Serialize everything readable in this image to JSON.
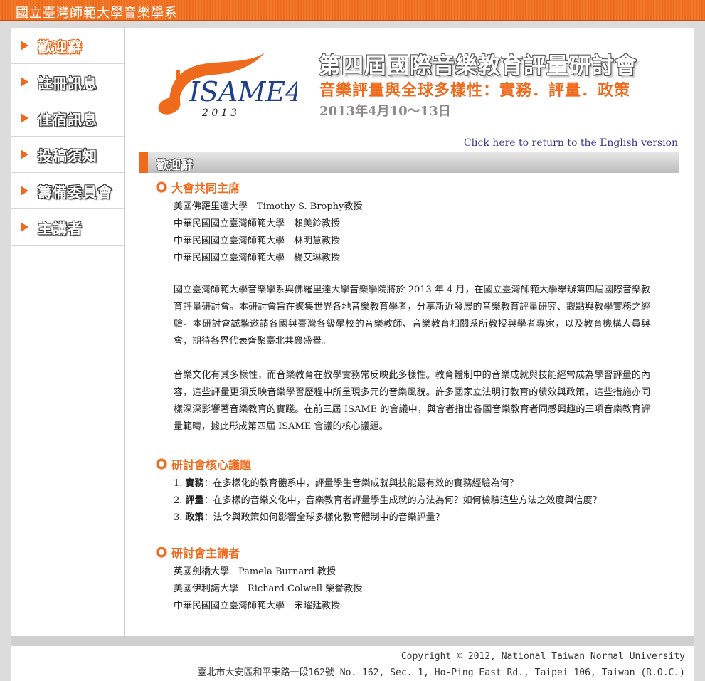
{
  "site": {
    "title": "國立臺灣師範大學音樂學系"
  },
  "sidebar": {
    "items": [
      {
        "label": "歡迎辭",
        "active": true
      },
      {
        "label": "註冊訊息",
        "active": false
      },
      {
        "label": "住宿訊息",
        "active": false
      },
      {
        "label": "投稿須知",
        "active": false
      },
      {
        "label": "籌備委員會",
        "active": false
      },
      {
        "label": "主講者",
        "active": false
      }
    ]
  },
  "header": {
    "logo_text": "ISAME4",
    "logo_year": "2 0 1 3",
    "title": "第四屆國際音樂教育評量研討會",
    "subtitle": "音樂評量與全球多樣性：實務．評量．政策",
    "date": "2013年4月10～13日",
    "english_link": "Click here to return to the English version"
  },
  "section": {
    "title": "歡迎辭"
  },
  "cochairs": {
    "heading": "大會共同主席",
    "lines": [
      "美國佛羅里達大學　Timothy S. Brophy教授",
      "中華民國國立臺灣師範大學　賴美鈴教授",
      "中華民國國立臺灣師範大學　林明慧教授",
      "中華民國國立臺灣師範大學　楊艾琳教授"
    ]
  },
  "intro": {
    "p1": "國立臺灣師範大學音樂學系與佛羅里達大學音樂學院將於 2013 年 4 月，在國立臺灣師範大學舉辦第四屆國際音樂教育評量研討會。本研討會旨在聚集世界各地音樂教育學者，分享新近發展的音樂教育評量研究、觀點與教學實務之經驗。本研討會誠摯邀請各國與臺灣各級學校的音樂教師、音樂教育相關系所教授與學者專家，以及教育機構人員與會，期待各界代表齊聚臺北共襄盛舉。",
    "p2": "音樂文化有其多樣性，而音樂教育在教學實務常反映此多樣性。教育體制中的音樂成就與技能經常成為學習評量的內容，這些評量更須反映音樂學習歷程中所呈現多元的音樂風貌。許多國家立法明訂教育的績效與政策，這些措施亦同樣深深影響著音樂教育的實踐。在前三屆 ISAME 的會議中，與會者指出各國音樂教育者同感興趣的三項音樂教育評量範疇，據此形成第四屆 ISAME 會議的核心議題。"
  },
  "themes": {
    "heading": "研討會核心議題",
    "items": [
      {
        "num": "1.",
        "term": "實務",
        "text": "：在多樣化的教育體系中，評量學生音樂成就與技能最有效的實務經驗為何？"
      },
      {
        "num": "2.",
        "term": "評量",
        "text": "：在多樣的音樂文化中，音樂教育者評量學生成就的方法為何？如何檢驗這些方法之效度與信度？"
      },
      {
        "num": "3.",
        "term": "政策",
        "text": "：法令與政策如何影響全球多樣化教育體制中的音樂評量？"
      }
    ]
  },
  "keynotes": {
    "heading": "研討會主講者",
    "lines": [
      "英國劍橋大學　Pamela Burnard 教授",
      "美國伊利諾大學　Richard Colwell 榮譽教授",
      "中華民國國立臺灣師範大學　宋曜廷教授"
    ]
  },
  "footer": {
    "copyright": "Copyright © 2012, National Taiwan Normal University",
    "address": "臺北市大安區和平東路一段162號  No. 162, Sec. 1, Ho-Ping East Rd., Taipei 106, Taiwan (R.O.C.)"
  },
  "colors": {
    "accent": "#ee6a1c",
    "link": "#3a3a8a",
    "logo_blue": "#1f3f8f"
  }
}
